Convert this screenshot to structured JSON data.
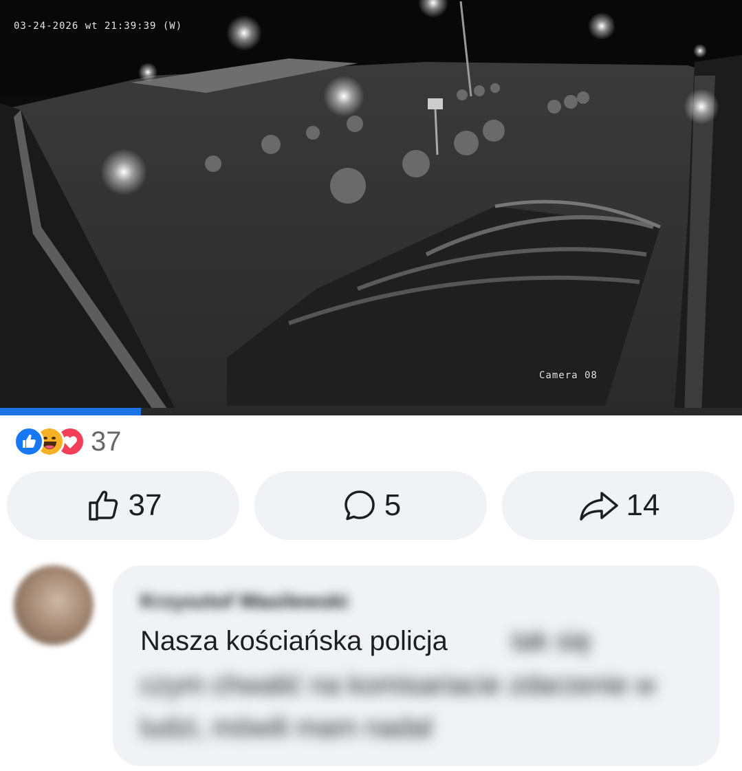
{
  "video": {
    "timestamp": "03-24-2026 wt 21:39:39 (W)",
    "camera_label": "Camera 08",
    "progress_fraction": 0.19
  },
  "reactions": {
    "types": [
      "like",
      "haha",
      "love"
    ],
    "count": "37"
  },
  "actions": {
    "like_count": "37",
    "comment_count": "5",
    "share_count": "14"
  },
  "comment": {
    "author": "Krzysztof Wasilewski",
    "text_visible": "Nasza kościańska policja",
    "text_blurred_1": "tak się",
    "text_blurred_2": "czym chwalić na komisariacie zdarzenie w",
    "text_blurred_3": "ludzi, mówili mam nadal"
  },
  "colors": {
    "accent": "#1b74e4",
    "like_blue": "#1877f2",
    "love_red": "#f33e58",
    "haha_yellow": "#f7b125",
    "button_bg": "#f0f2f5"
  }
}
